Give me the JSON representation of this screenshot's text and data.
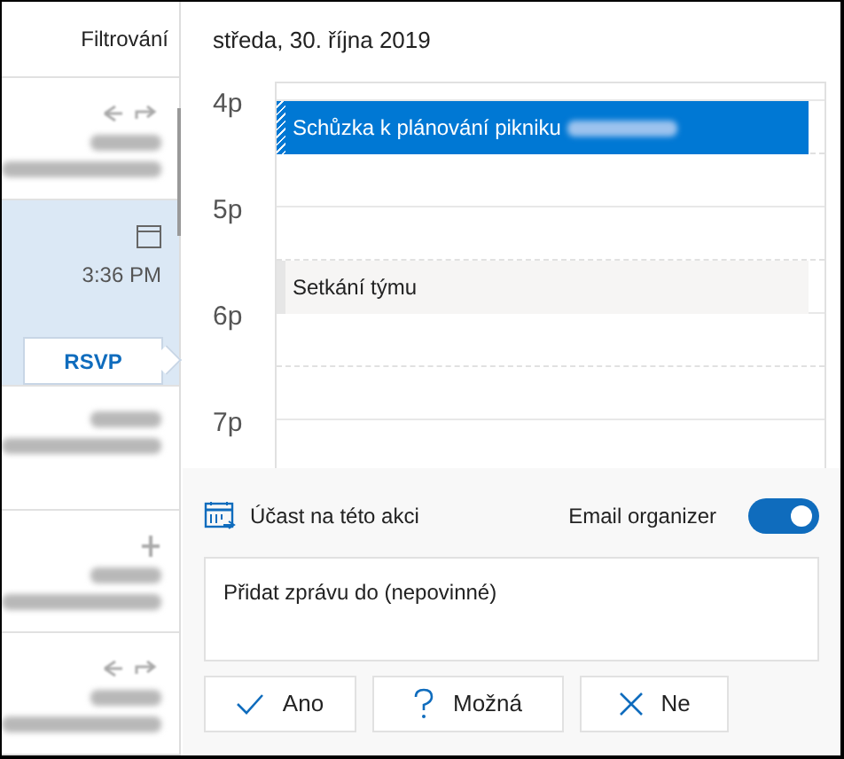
{
  "mail_list": {
    "header": "Filtrování",
    "items": [
      {
        "selected": false,
        "kind": "reply"
      },
      {
        "selected": true,
        "kind": "invite",
        "time": "3:36 PM",
        "action": "RSVP"
      },
      {
        "selected": false,
        "kind": "plain"
      },
      {
        "selected": false,
        "kind": "pin"
      },
      {
        "selected": false,
        "kind": "reply"
      }
    ]
  },
  "calendar": {
    "date": "středa, 30. října 2019",
    "hours": [
      "4p",
      "5p",
      "6p",
      "7p"
    ],
    "events": [
      {
        "title": "Schůzka k plánování pikniku",
        "selected": true
      },
      {
        "title": "Setkání týmu",
        "selected": false
      }
    ]
  },
  "response": {
    "label": "Účast na této akci",
    "email_organizer": {
      "label": "Email organizer",
      "on": true
    },
    "message": {
      "placeholder": "Přidat zprávu do (nepovinné)"
    },
    "buttons": [
      {
        "label": "Ano",
        "kind": "yes"
      },
      {
        "label": "Možná",
        "kind": "maybe"
      },
      {
        "label": "Ne",
        "kind": "no"
      }
    ]
  }
}
